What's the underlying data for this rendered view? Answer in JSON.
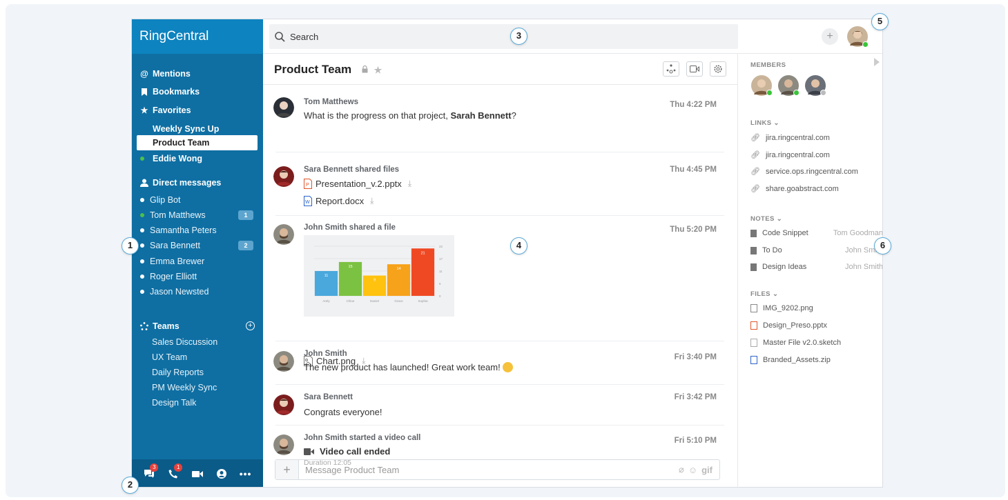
{
  "app": {
    "brand": "RingCentral"
  },
  "sidebar": {
    "mentions": "Mentions",
    "bookmarks": "Bookmarks",
    "favorites": "Favorites",
    "favorite_items": [
      "Weekly Sync Up",
      "Product Team",
      "Eddie Wong"
    ],
    "direct_messages": "Direct messages",
    "dms": [
      {
        "name": "Glip Bot",
        "badge": ""
      },
      {
        "name": "Tom Matthews",
        "badge": "1"
      },
      {
        "name": "Samantha Peters",
        "badge": ""
      },
      {
        "name": "Sara Bennett",
        "badge": "2"
      },
      {
        "name": "Emma Brewer",
        "badge": ""
      },
      {
        "name": "Roger Elliott",
        "badge": ""
      },
      {
        "name": "Jason Newsted",
        "badge": ""
      }
    ],
    "teams": "Teams",
    "team_items": [
      "Sales Discussion",
      "UX Team",
      "Daily Reports",
      "PM Weekly Sync",
      "Design Talk"
    ],
    "bottom_badges": {
      "messages": "3",
      "phone": "1"
    }
  },
  "search": {
    "placeholder": "Search"
  },
  "conversation": {
    "title": "Product Team",
    "messages": [
      {
        "who": "Tom Matthews",
        "text": "What is the progress on that project, ",
        "bold": "Sarah Bennett",
        "tail": "?",
        "time": "Thu 4:22 PM"
      },
      {
        "who": "Sara Bennett shared files",
        "files": [
          "Presentation_v.2.pptx",
          "Report.docx"
        ],
        "time": "Thu 4:45 PM"
      },
      {
        "who": "John Smith shared a file",
        "file": "Chart.png",
        "time": "Thu 5:20 PM"
      },
      {
        "who": "John Smith",
        "text": "The new product has launched! Great work team!",
        "time": "Fri 3:40 PM"
      },
      {
        "who": "Sara Bennett",
        "text": "Congrats everyone!",
        "time": "Fri 3:42 PM"
      },
      {
        "who": "John Smith started a video call",
        "text": "Video call ended",
        "sub": "Duration 12:05",
        "time": "Fri 5:10 PM"
      }
    ],
    "compose_placeholder": "Message Product Team",
    "gif_label": "gif"
  },
  "chart_data": {
    "type": "bar",
    "categories": [
      "Arely",
      "Chloe",
      "Daniel",
      "Grace",
      "Sophia"
    ],
    "values": [
      11,
      15,
      9,
      14,
      21
    ],
    "ylim": [
      0,
      22
    ],
    "yticks": [
      "22",
      "17",
      "11",
      "6",
      "0"
    ],
    "colors": [
      "#4aa8dc",
      "#7cc242",
      "#ffc20e",
      "#f7a21b",
      "#ef4923"
    ]
  },
  "right_panel": {
    "members_label": "MEMBERS",
    "links_label": "LINKS",
    "links": [
      "jira.ringcentral.com",
      "jira.ringcentral.com",
      "service.ops.ringcentral.com",
      "share.goabstract.com"
    ],
    "notes_label": "NOTES",
    "notes": [
      {
        "title": "Code Snippet",
        "by": "Tom Goodman"
      },
      {
        "title": "To Do",
        "by": "John Smith"
      },
      {
        "title": "Design Ideas",
        "by": "John Smith"
      }
    ],
    "files_label": "FILES",
    "files": [
      "IMG_9202.png",
      "Design_Preso.pptx",
      "Master File v2.0.sketch",
      "Branded_Assets.zip"
    ]
  },
  "callouts": [
    "1",
    "2",
    "3",
    "4",
    "5",
    "6"
  ],
  "colors": {
    "sidebar": "#0f6fa3",
    "brand_bar": "#0d83bf",
    "online": "#3ac43a",
    "notify": "#e8413c"
  }
}
